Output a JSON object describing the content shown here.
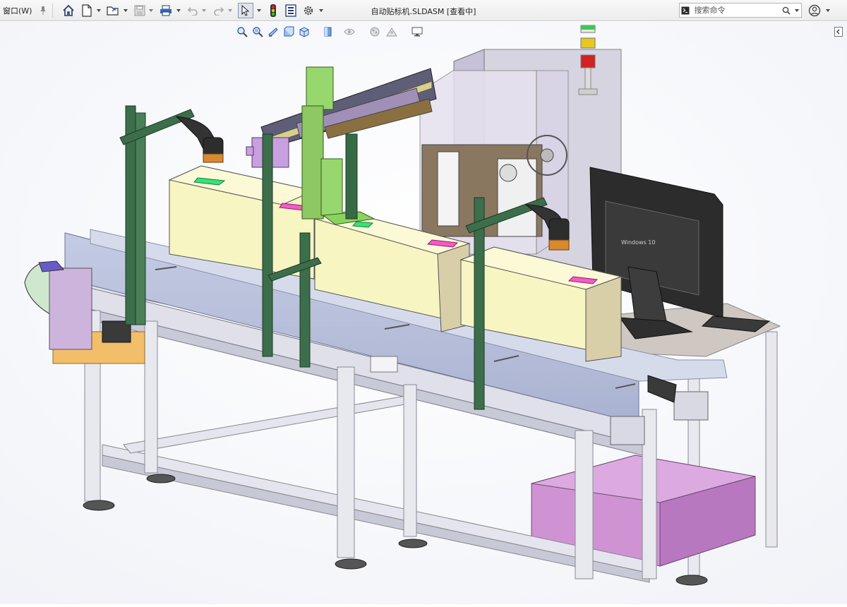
{
  "menu": {
    "window_label": "窗口(W)"
  },
  "document": {
    "title": "自动贴标机.SLDASM [查看中]"
  },
  "search": {
    "placeholder": "搜索命令"
  },
  "screen": {
    "taskbar_text": "Windows 10"
  },
  "colors": {
    "toolbar_bg": "#efefef",
    "viewport_bg": "#ffffff",
    "frame_aluminum": "#dcdde6",
    "conveyor_belt_plate": "#b4bdd8",
    "box_fill": "#f8f6c4",
    "label_green": "#35e37a",
    "label_pink": "#f55ac7",
    "gantry_green": "#97d86e",
    "post_dark_green": "#3c6e4b",
    "cabinet_pink": "#d49ad6",
    "head_purple": "#c8a0e0",
    "enclosure_glass": "#d9d4e3",
    "monitor_black": "#2c2c2c",
    "motor_mint": "#cfe7cf",
    "orange_tray": "#f2be6a",
    "tower_light_green": "#3ec850",
    "tower_light_yellow": "#e6c820",
    "tower_light_red": "#d22222"
  },
  "icons": [
    "pin-icon",
    "home-icon",
    "new-file-icon",
    "open-folder-icon",
    "save-icon",
    "print-icon",
    "undo-icon",
    "redo-icon",
    "select-cursor-icon",
    "traffic-light-icon",
    "file-properties-icon",
    "options-gear-icon",
    "command-search-icon",
    "magnifier-icon",
    "help-icon",
    "zoom-to-fit-icon",
    "zoom-area-icon",
    "previous-view-icon",
    "section-view-icon",
    "view-orientation-icon",
    "display-style-icon",
    "hide-show-icon",
    "appearance-icon",
    "scene-icon",
    "display-settings-icon",
    "panel-expand-icon"
  ]
}
